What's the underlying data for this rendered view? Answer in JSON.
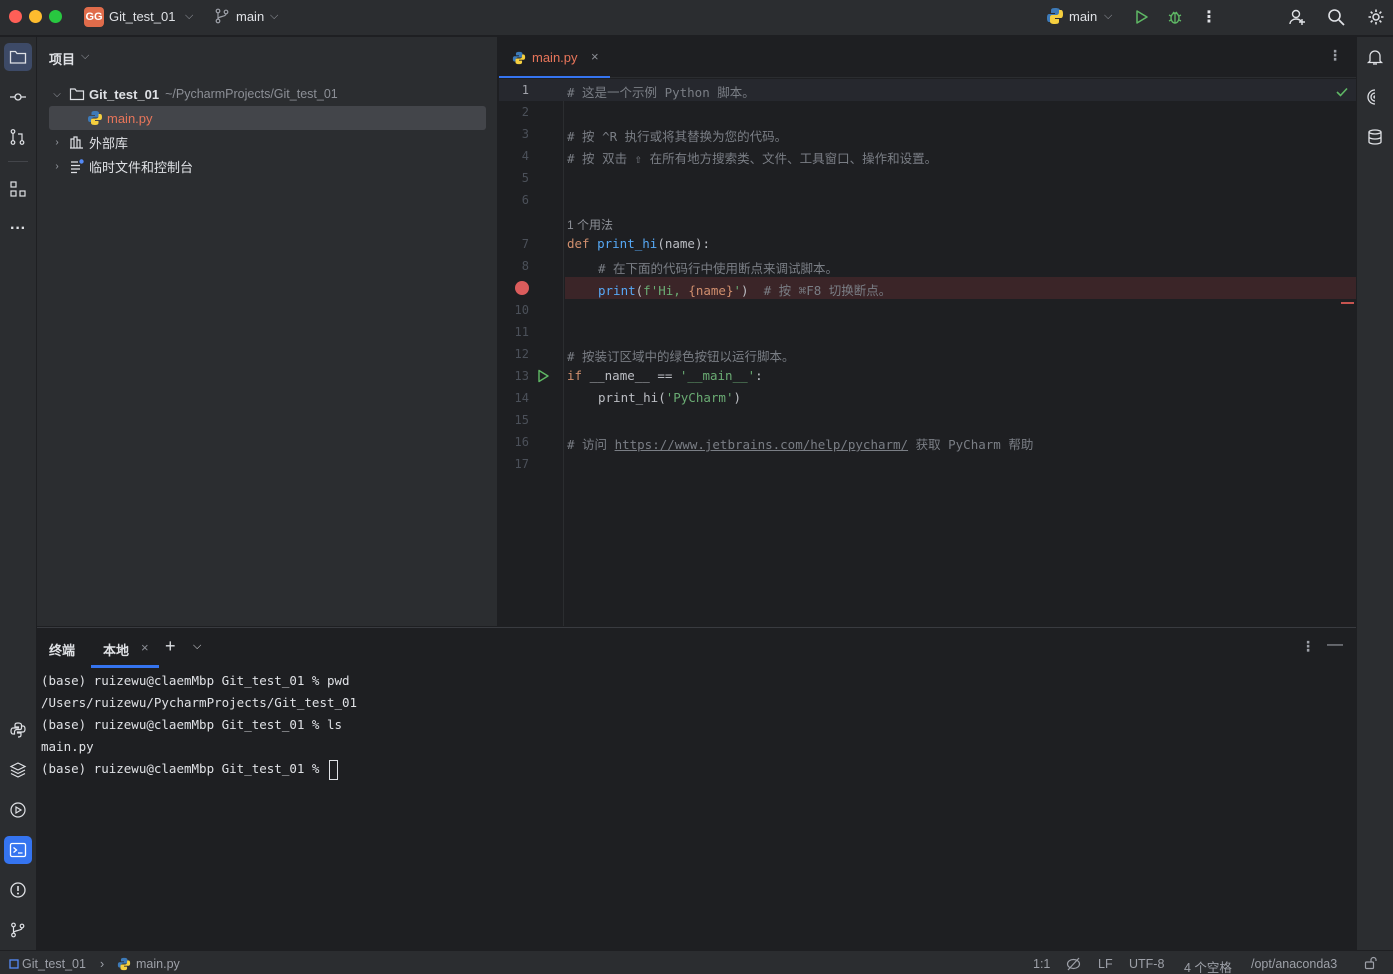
{
  "titlebar": {
    "project_badge": "GG",
    "project_name": "Git_test_01",
    "branch": "main",
    "run_config": "main"
  },
  "project_panel": {
    "title": "项目",
    "tree": [
      {
        "label": "Git_test_01",
        "path": "~/PycharmProjects/Git_test_01",
        "type": "folder",
        "expanded": true
      },
      {
        "label": "main.py",
        "type": "python-file",
        "selected": true
      },
      {
        "label": "外部库",
        "type": "library",
        "expanded": false
      },
      {
        "label": "临时文件和控制台",
        "type": "scratches",
        "expanded": false
      }
    ]
  },
  "editor": {
    "tab_label": "main.py",
    "lines": [
      {
        "n": "1",
        "text": "# 这是一个示例 Python 脚本。"
      },
      {
        "n": "2",
        "text": ""
      },
      {
        "n": "3",
        "text": "# 按 ^R 执行或将其替换为您的代码。"
      },
      {
        "n": "4",
        "text": "# 按 双击 ⇧ 在所有地方搜索类、文件、工具窗口、操作和设置。"
      },
      {
        "n": "5",
        "text": ""
      },
      {
        "n": "6",
        "text": ""
      },
      {
        "n": "",
        "text": "1 个用法"
      },
      {
        "n": "7",
        "text": "def print_hi(name):"
      },
      {
        "n": "8",
        "text": "    # 在下面的代码行中使用断点来调试脚本。"
      },
      {
        "n": "9",
        "text": "    print(f'Hi, {name}')  # 按 ⌘F8 切换断点。"
      },
      {
        "n": "10",
        "text": ""
      },
      {
        "n": "11",
        "text": ""
      },
      {
        "n": "12",
        "text": "# 按装订区域中的绿色按钮以运行脚本。"
      },
      {
        "n": "13",
        "text": "if __name__ == '__main__':"
      },
      {
        "n": "14",
        "text": "    print_hi('PyCharm')"
      },
      {
        "n": "15",
        "text": ""
      },
      {
        "n": "16",
        "text": "# 访问 https://www.jetbrains.com/help/pycharm/ 获取 PyCharm 帮助"
      },
      {
        "n": "17",
        "text": ""
      }
    ],
    "parts": {
      "l1": "# 这是一个示例 Python 脚本。",
      "l3": "# 按 ^R 执行或将其替换为您的代码。",
      "l4": "# 按 双击 ⇧ 在所有地方搜索类、文件、工具窗口、操作和设置。",
      "usage": "1 个用法",
      "l7_def": "def",
      "l7_fn": "print_hi",
      "l7_rest": "(name):",
      "l8": "# 在下面的代码行中使用断点来调试脚本。",
      "l9_print": "print",
      "l9_open": "(",
      "l9_fstr1": "f'Hi, ",
      "l9_brace": "{name}",
      "l9_fstr2": "'",
      "l9_close": ")",
      "l9_comment": "# 按 ⌘F8 切换断点。",
      "l12": "# 按装订区域中的绿色按钮以运行脚本。",
      "l13_if": "if",
      "l13_mid": " __name__ == ",
      "l13_str": "'__main__'",
      "l13_end": ":",
      "l14_call": "print_hi(",
      "l14_str": "'PyCharm'",
      "l14_end": ")",
      "l16_pre": "# 访问 ",
      "l16_link": "https://www.jetbrains.com/help/pycharm/",
      "l16_post": " 获取 PyCharm 帮助"
    }
  },
  "terminal": {
    "title": "终端",
    "tab_label": "本地",
    "lines": [
      "(base) ruizewu@claemMbp Git_test_01 % pwd",
      "/Users/ruizewu/PycharmProjects/Git_test_01",
      "(base) ruizewu@claemMbp Git_test_01 % ls",
      "main.py",
      "(base) ruizewu@claemMbp Git_test_01 % "
    ]
  },
  "statusbar": {
    "project": "Git_test_01",
    "file": "main.py",
    "position": "1:1",
    "line_sep": "LF",
    "encoding": "UTF-8",
    "indent": "4 个空格",
    "interpreter": "/opt/anaconda3"
  },
  "colors": {
    "accent": "#3574f0",
    "breakpoint": "#db5c5c",
    "python_file": "#e8755a",
    "background": "#1e1f22",
    "panel": "#2b2d30"
  }
}
